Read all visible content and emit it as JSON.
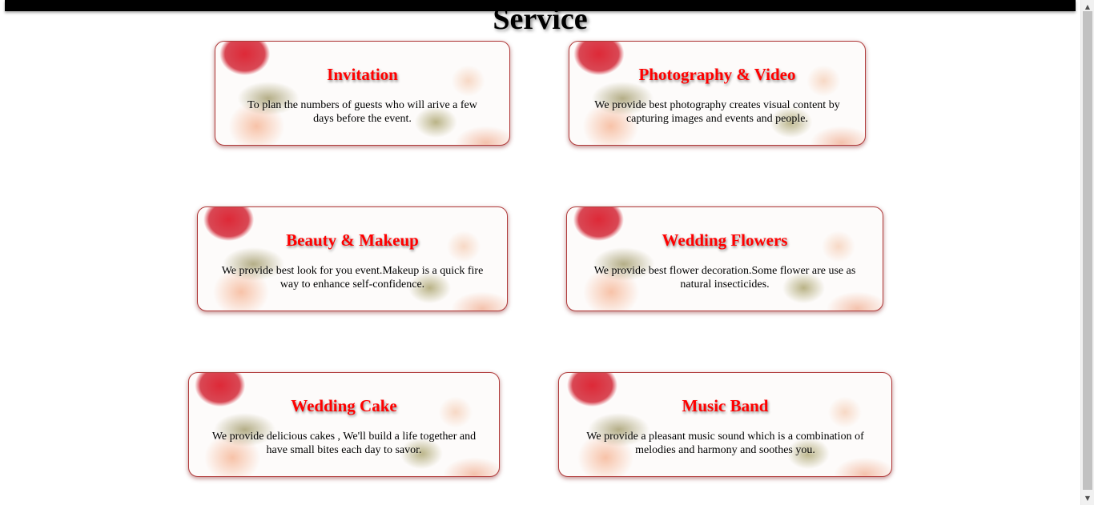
{
  "page": {
    "title": "Service"
  },
  "services": [
    {
      "title": "Invitation",
      "description": "To plan the numbers of guests who will arive a few days before the event."
    },
    {
      "title": "Photography & Video",
      "description": "We provide best photography creates visual content by capturing images and events and people."
    },
    {
      "title": "Beauty & Makeup",
      "description": "We provide best look for you event.Makeup is a quick fire way to enhance self-confidence."
    },
    {
      "title": "Wedding Flowers",
      "description": "We provide best flower decoration.Some flower are use as natural insecticides."
    },
    {
      "title": "Wedding Cake",
      "description": "We provide delicious cakes , We'll build a life together and have small bites each day to savor."
    },
    {
      "title": "Music Band",
      "description": "We provide a pleasant music sound which is a combination of melodies and harmony and soothes you."
    }
  ],
  "scrollbar": {
    "up_icon": "triangle-up-icon",
    "down_icon": "triangle-down-icon"
  },
  "colors": {
    "card_title": "#ff0000",
    "card_border": "#b03a3a",
    "top_bar": "#000000"
  }
}
